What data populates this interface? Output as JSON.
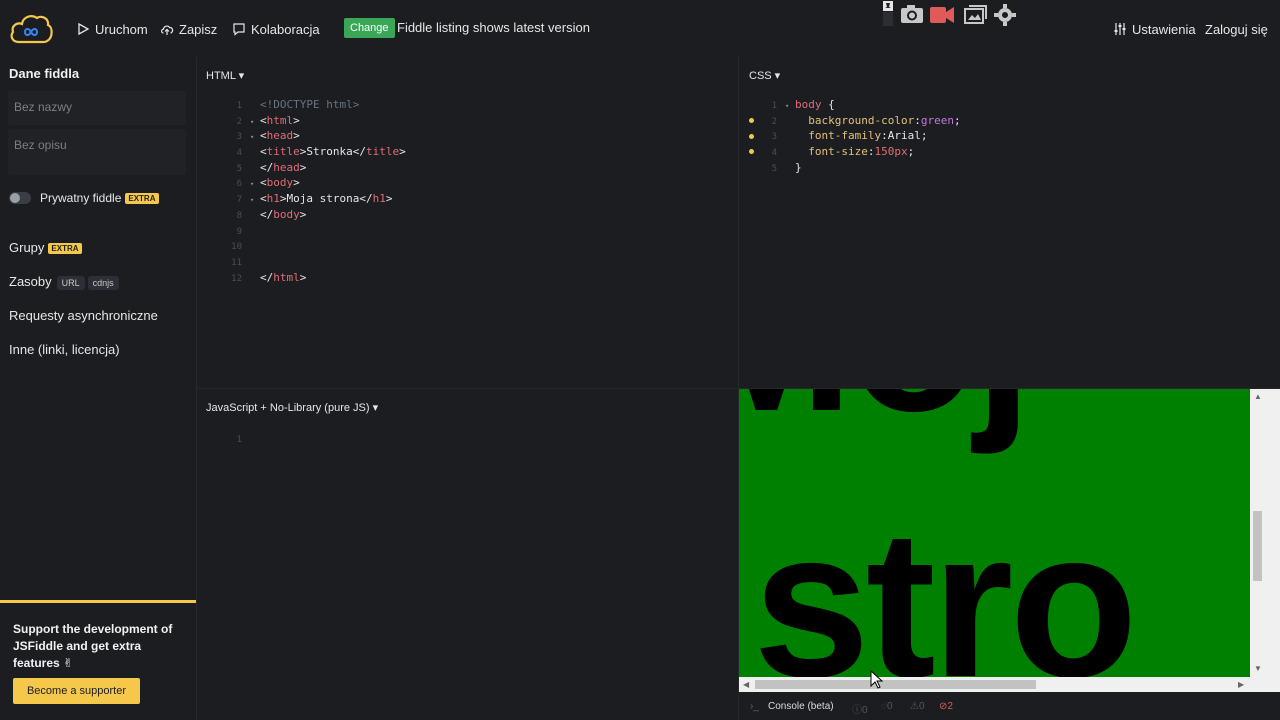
{
  "topbar": {
    "run": "Uruchom",
    "save": "Zapisz",
    "collab": "Kolaboracja",
    "change_badge": "Change",
    "change_text": "Fiddle listing shows latest version",
    "settings": "Ustawienia",
    "login": "Zaloguj się"
  },
  "sidebar": {
    "title": "Dane fiddla",
    "name_placeholder": "Bez nazwy",
    "desc_placeholder": "Bez opisu",
    "private_label": "Prywatny fiddle",
    "extra_badge": "EXTRA",
    "groups": "Grupy",
    "resources": "Zasoby",
    "tag_url": "URL",
    "tag_cdnjs": "cdnjs",
    "ajax": "Requesty asynchroniczne",
    "other": "Inne (linki, licencja)",
    "support_text": "Support the development of JSFiddle and get extra features ✌",
    "support_button": "Become a supporter"
  },
  "panels": {
    "html_label": "HTML ▾",
    "css_label": "CSS ▾",
    "js_label": "JavaScript + No-Library (pure JS) ▾"
  },
  "html_code": [
    {
      "ln": "1",
      "fold": "",
      "parts": [
        [
          "doc",
          "<!DOCTYPE html>"
        ]
      ]
    },
    {
      "ln": "2",
      "fold": "▾",
      "parts": [
        [
          "txt",
          "<"
        ],
        [
          "tag",
          "html"
        ],
        [
          "txt",
          ">"
        ]
      ]
    },
    {
      "ln": "3",
      "fold": "▾",
      "parts": [
        [
          "txt",
          "<"
        ],
        [
          "tag",
          "head"
        ],
        [
          "txt",
          ">"
        ]
      ]
    },
    {
      "ln": "4",
      "fold": "",
      "parts": [
        [
          "txt",
          "<"
        ],
        [
          "tag",
          "title"
        ],
        [
          "txt",
          ">Stronka</"
        ],
        [
          "tag",
          "title"
        ],
        [
          "txt",
          ">"
        ]
      ]
    },
    {
      "ln": "5",
      "fold": "",
      "parts": [
        [
          "txt",
          "</"
        ],
        [
          "tag",
          "head"
        ],
        [
          "txt",
          ">"
        ]
      ]
    },
    {
      "ln": "6",
      "fold": "▾",
      "parts": [
        [
          "txt",
          "<"
        ],
        [
          "tag",
          "body"
        ],
        [
          "txt",
          ">"
        ]
      ]
    },
    {
      "ln": "7",
      "fold": "▾",
      "parts": [
        [
          "txt",
          "<"
        ],
        [
          "tag",
          "h1"
        ],
        [
          "txt",
          ">Moja strona</"
        ],
        [
          "tag",
          "h1"
        ],
        [
          "txt",
          ">"
        ]
      ]
    },
    {
      "ln": "8",
      "fold": "",
      "parts": [
        [
          "txt",
          "</"
        ],
        [
          "tag",
          "body"
        ],
        [
          "txt",
          ">"
        ]
      ]
    },
    {
      "ln": "9",
      "fold": "",
      "parts": []
    },
    {
      "ln": "10",
      "fold": "",
      "parts": []
    },
    {
      "ln": "11",
      "fold": "",
      "parts": []
    },
    {
      "ln": "12",
      "fold": "",
      "parts": [
        [
          "txt",
          "</"
        ],
        [
          "tag",
          "html"
        ],
        [
          "txt",
          ">"
        ]
      ]
    }
  ],
  "css_code": [
    {
      "ln": "1",
      "fold": "▾",
      "parts": [
        [
          "sel",
          "body"
        ],
        [
          "txt",
          " {"
        ]
      ]
    },
    {
      "ln": "2",
      "fold": "",
      "parts": [
        [
          "txt",
          "  "
        ],
        [
          "prop",
          "background-color"
        ],
        [
          "txt",
          ":"
        ],
        [
          "val",
          "green"
        ],
        [
          "txt",
          ";"
        ]
      ]
    },
    {
      "ln": "3",
      "fold": "",
      "parts": [
        [
          "txt",
          "  "
        ],
        [
          "prop",
          "font-family"
        ],
        [
          "txt",
          ":Arial;"
        ]
      ]
    },
    {
      "ln": "4",
      "fold": "",
      "parts": [
        [
          "txt",
          "  "
        ],
        [
          "prop",
          "font-size"
        ],
        [
          "txt",
          ":"
        ],
        [
          "num",
          "150px"
        ],
        [
          "txt",
          ";"
        ]
      ]
    },
    {
      "ln": "5",
      "fold": "",
      "parts": [
        [
          "txt",
          "}"
        ]
      ]
    }
  ],
  "js_code": [
    {
      "ln": "1",
      "fold": "",
      "parts": []
    }
  ],
  "result": {
    "line1": "Moj",
    "line2": "stro"
  },
  "console": {
    "label": "Console (beta)",
    "count_info": "0",
    "count_log": "0",
    "count_warn": "0",
    "count_err": "2"
  }
}
